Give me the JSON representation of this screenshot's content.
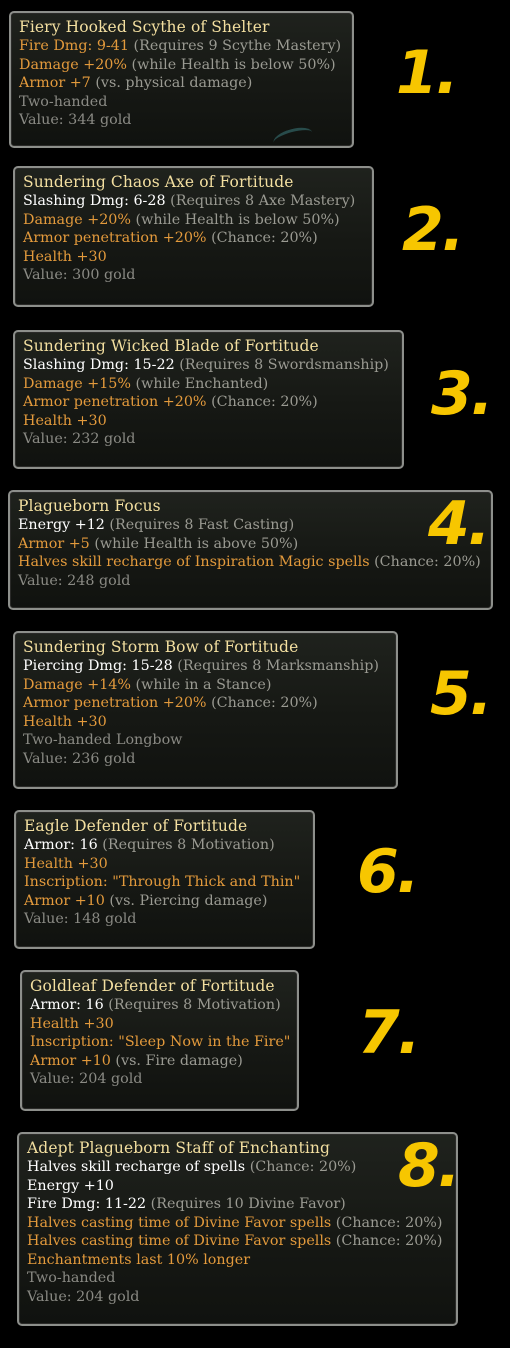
{
  "items": [
    {
      "number": "1.",
      "title": "Fiery Hooked Scythe of Shelter",
      "lines": [
        [
          {
            "t": "Fire Dmg: 9-41",
            "c": "o"
          },
          {
            "t": " (Requires 9 Scythe Mastery)",
            "c": "g"
          }
        ],
        [
          {
            "t": "Damage +20%",
            "c": "o"
          },
          {
            "t": " (while Health is below 50%)",
            "c": "g"
          }
        ],
        [
          {
            "t": "Armor +7",
            "c": "o"
          },
          {
            "t": " (vs. physical damage)",
            "c": "g"
          }
        ],
        [
          {
            "t": "Two-handed",
            "c": "gr"
          }
        ],
        [
          {
            "t": "Value: 344 gold",
            "c": "gr"
          }
        ]
      ]
    },
    {
      "number": "2.",
      "title": "Sundering Chaos Axe of Fortitude",
      "lines": [
        [
          {
            "t": "Slashing Dmg: 6-28",
            "c": "w"
          },
          {
            "t": " (Requires 8 Axe Mastery)",
            "c": "g"
          }
        ],
        [
          {
            "t": "Damage +20%",
            "c": "o"
          },
          {
            "t": " (while Health is below 50%)",
            "c": "g"
          }
        ],
        [
          {
            "t": "Armor penetration +20%",
            "c": "o"
          },
          {
            "t": " (Chance: 20%)",
            "c": "g"
          }
        ],
        [
          {
            "t": "Health +30",
            "c": "o"
          }
        ],
        [
          {
            "t": "Value: 300 gold",
            "c": "gr"
          }
        ]
      ]
    },
    {
      "number": "3.",
      "title": "Sundering Wicked Blade of Fortitude",
      "lines": [
        [
          {
            "t": "Slashing Dmg: 15-22",
            "c": "w"
          },
          {
            "t": " (Requires 8 Swordsmanship)",
            "c": "g"
          }
        ],
        [
          {
            "t": "Damage +15%",
            "c": "o"
          },
          {
            "t": " (while Enchanted)",
            "c": "g"
          }
        ],
        [
          {
            "t": "Armor penetration +20%",
            "c": "o"
          },
          {
            "t": " (Chance: 20%)",
            "c": "g"
          }
        ],
        [
          {
            "t": "Health +30",
            "c": "o"
          }
        ],
        [
          {
            "t": "Value: 232 gold",
            "c": "gr"
          }
        ]
      ]
    },
    {
      "number": "4.",
      "title": "Plagueborn Focus",
      "lines": [
        [
          {
            "t": "Energy +12",
            "c": "w"
          },
          {
            "t": " (Requires 8 Fast Casting)",
            "c": "g"
          }
        ],
        [
          {
            "t": "Armor +5",
            "c": "o"
          },
          {
            "t": " (while Health is above 50%)",
            "c": "g"
          }
        ],
        [
          {
            "t": "Halves skill recharge of Inspiration Magic spells",
            "c": "o"
          },
          {
            "t": " (Chance: 20%)",
            "c": "g"
          }
        ],
        [
          {
            "t": "Value: 248 gold",
            "c": "gr"
          }
        ]
      ]
    },
    {
      "number": "5.",
      "title": "Sundering Storm Bow of Fortitude",
      "lines": [
        [
          {
            "t": "Piercing Dmg: 15-28",
            "c": "w"
          },
          {
            "t": " (Requires 8 Marksmanship)",
            "c": "g"
          }
        ],
        [
          {
            "t": "Damage +14%",
            "c": "o"
          },
          {
            "t": " (while in a Stance)",
            "c": "g"
          }
        ],
        [
          {
            "t": "Armor penetration +20%",
            "c": "o"
          },
          {
            "t": " (Chance: 20%)",
            "c": "g"
          }
        ],
        [
          {
            "t": "Health +30",
            "c": "o"
          }
        ],
        [
          {
            "t": "Two-handed Longbow",
            "c": "gr"
          }
        ],
        [
          {
            "t": "Value: 236 gold",
            "c": "gr"
          }
        ]
      ]
    },
    {
      "number": "6.",
      "title": "Eagle Defender of Fortitude",
      "lines": [
        [
          {
            "t": "Armor: 16",
            "c": "w"
          },
          {
            "t": " (Requires 8 Motivation)",
            "c": "g"
          }
        ],
        [
          {
            "t": "Health +30",
            "c": "o"
          }
        ],
        [
          {
            "t": "Inscription: \"Through Thick and Thin\"",
            "c": "o"
          }
        ],
        [
          {
            "t": "Armor +10",
            "c": "o"
          },
          {
            "t": " (vs. Piercing damage)",
            "c": "g"
          }
        ],
        [
          {
            "t": "Value: 148 gold",
            "c": "gr"
          }
        ]
      ]
    },
    {
      "number": "7.",
      "title": "Goldleaf Defender of Fortitude",
      "lines": [
        [
          {
            "t": "Armor: 16",
            "c": "w"
          },
          {
            "t": " (Requires 8 Motivation)",
            "c": "g"
          }
        ],
        [
          {
            "t": "Health +30",
            "c": "o"
          }
        ],
        [
          {
            "t": "Inscription: \"Sleep Now in the Fire\"",
            "c": "o"
          }
        ],
        [
          {
            "t": "Armor +10",
            "c": "o"
          },
          {
            "t": " (vs. Fire damage)",
            "c": "g"
          }
        ],
        [
          {
            "t": "Value: 204 gold",
            "c": "gr"
          }
        ]
      ]
    },
    {
      "number": "8.",
      "title": "Adept Plagueborn Staff of Enchanting",
      "lines": [
        [
          {
            "t": "Halves skill recharge of spells",
            "c": "w"
          },
          {
            "t": " (Chance: 20%)",
            "c": "g"
          }
        ],
        [
          {
            "t": "Energy +10",
            "c": "w"
          }
        ],
        [
          {
            "t": "Fire Dmg: 11-22",
            "c": "w"
          },
          {
            "t": " (Requires 10 Divine Favor)",
            "c": "g"
          }
        ],
        [
          {
            "t": "Halves casting time of Divine Favor spells",
            "c": "o"
          },
          {
            "t": " (Chance: 20%)",
            "c": "g"
          }
        ],
        [
          {
            "t": "Halves casting time of Divine Favor spells",
            "c": "o"
          },
          {
            "t": " (Chance: 20%)",
            "c": "g"
          }
        ],
        [
          {
            "t": "Enchantments last 10% longer",
            "c": "o"
          }
        ],
        [
          {
            "t": "Two-handed",
            "c": "gr"
          }
        ],
        [
          {
            "t": "Value: 204 gold",
            "c": "gr"
          }
        ]
      ]
    }
  ]
}
